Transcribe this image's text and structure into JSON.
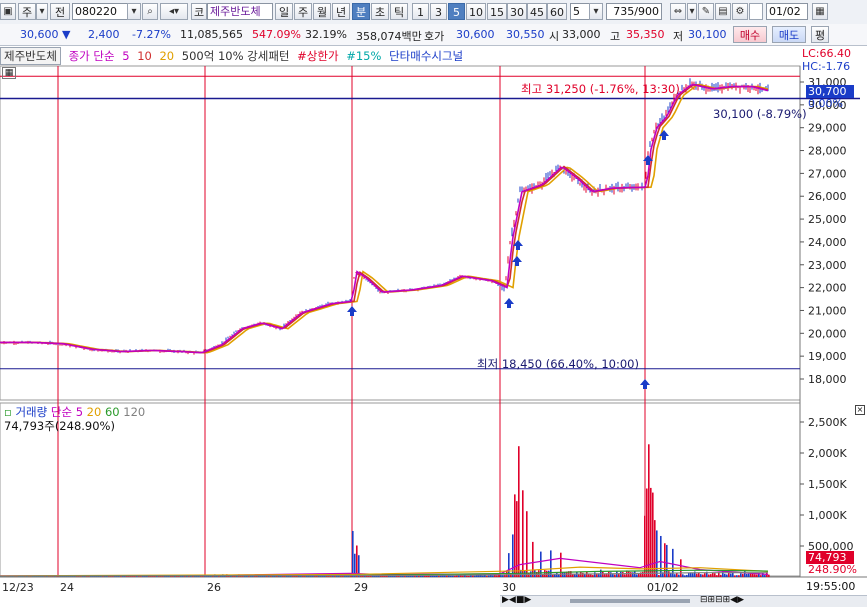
{
  "toolbar": {
    "market_label": "주",
    "type_label": "전",
    "code": "080220",
    "kospi_label": "코",
    "stock_name": "제주반도체",
    "periods": [
      "일",
      "주",
      "월",
      "년",
      "분",
      "초",
      "틱"
    ],
    "selected_period": "분",
    "intervals": [
      "1",
      "3",
      "5",
      "10",
      "15",
      "30",
      "45",
      "60"
    ],
    "selected_interval": "5",
    "interval_value": "5",
    "count": "735/900",
    "date": "01/02"
  },
  "quote": {
    "price": "30,600",
    "arrow": "▼",
    "change": "2,400",
    "change_pct": "-7.27%",
    "volume": "11,085,565",
    "volume_ratio": "547.09%",
    "turnover": "32.19%",
    "amount": "358,074백만",
    "ask_label": "호가",
    "ask_price": "30,600",
    "bid_price": "30,550",
    "open_label": "시",
    "open": "33,000",
    "high_label": "고",
    "high": "35,350",
    "low_label": "저",
    "low": "30,100",
    "buy_btn": "매수",
    "sell_btn": "매도",
    "eval_btn": "평"
  },
  "legend": {
    "name": "제주반도체",
    "close_label": "종가 단순",
    "ma5": "5",
    "ma10": "10",
    "ma20": "20",
    "pattern": "500억 10% 강세패턴",
    "upper_limit": "#상한가",
    "pct15": "#15%",
    "signal": "단타매수시그널"
  },
  "lc_hc": {
    "lc": "LC:66.40",
    "hc": "HC:-1.76"
  },
  "price_tag": "30,700",
  "zero_pct": "0.00%",
  "annotations": {
    "high": "최고 31,250 (-1.76%, 13:30)",
    "low_mid": "30,100 (-8.79%)",
    "low": "최저 18,450 (66.40%, 10:00)"
  },
  "volume_legend": {
    "label": "거래량",
    "ma_label": "단순",
    "ma5": "5",
    "ma20": "20",
    "ma60": "60",
    "ma120": "120",
    "current": "74,793주(248.90%)"
  },
  "vol_tags": {
    "value": "74,793",
    "pct": "248.90%"
  },
  "time_label": "19:55:00",
  "colors": {
    "up": "#e0002a",
    "down": "#1a3cc8",
    "ma5": "#c000c0",
    "ma10": "#d03030",
    "ma20": "#e0a000",
    "ma60": "#2a9a2a",
    "ma120": "#808080"
  },
  "chart_data": {
    "type": "candlestick",
    "x_tick_labels": [
      "12/23",
      "24",
      "26",
      "29",
      "30",
      "01/02"
    ],
    "price_axis": [
      "31,000",
      "30,000",
      "29,000",
      "28,000",
      "27,000",
      "26,000",
      "25,000",
      "24,000",
      "23,000",
      "22,000",
      "21,000",
      "20,000",
      "19,000",
      "18,000"
    ],
    "price_ylim": [
      17400,
      31600
    ],
    "volume_axis": [
      "2,500K",
      "2,000K",
      "1,500K",
      "1,000K",
      "500,000"
    ],
    "volume_ylim": [
      0,
      2750000
    ],
    "price_path": [
      [
        0,
        19600
      ],
      [
        30,
        19600
      ],
      [
        60,
        19550
      ],
      [
        90,
        19300
      ],
      [
        120,
        19200
      ],
      [
        150,
        19250
      ],
      [
        180,
        19200
      ],
      [
        200,
        19150
      ],
      [
        220,
        19500
      ],
      [
        240,
        20200
      ],
      [
        260,
        20450
      ],
      [
        280,
        20200
      ],
      [
        300,
        20900
      ],
      [
        330,
        21300
      ],
      [
        350,
        21400
      ],
      [
        355,
        22700
      ],
      [
        365,
        22400
      ],
      [
        380,
        21800
      ],
      [
        410,
        21900
      ],
      [
        440,
        22100
      ],
      [
        460,
        22500
      ],
      [
        490,
        22300
      ],
      [
        505,
        22000
      ],
      [
        510,
        24000
      ],
      [
        520,
        26200
      ],
      [
        540,
        26500
      ],
      [
        560,
        27300
      ],
      [
        575,
        26800
      ],
      [
        590,
        26200
      ],
      [
        610,
        26350
      ],
      [
        645,
        26400
      ],
      [
        648,
        27900
      ],
      [
        655,
        29000
      ],
      [
        665,
        29500
      ],
      [
        675,
        30400
      ],
      [
        690,
        30900
      ],
      [
        710,
        30700
      ],
      [
        730,
        30800
      ],
      [
        750,
        30800
      ],
      [
        768,
        30600
      ]
    ],
    "volume_spikes": [
      [
        352,
        700000
      ],
      [
        355,
        450000
      ],
      [
        358,
        300000
      ],
      [
        508,
        350000
      ],
      [
        512,
        600000
      ],
      [
        515,
        1200000
      ],
      [
        518,
        1900000
      ],
      [
        522,
        1400000
      ],
      [
        526,
        900000
      ],
      [
        532,
        700000
      ],
      [
        540,
        500000
      ],
      [
        550,
        420000
      ],
      [
        560,
        350000
      ],
      [
        645,
        1200000
      ],
      [
        648,
        2100000
      ],
      [
        651,
        1700000
      ],
      [
        655,
        900000
      ],
      [
        660,
        700000
      ],
      [
        665,
        500000
      ],
      [
        672,
        400000
      ],
      [
        680,
        300000
      ]
    ],
    "buy_signals_x": [
      352,
      509,
      517,
      518,
      645,
      648,
      664
    ]
  }
}
